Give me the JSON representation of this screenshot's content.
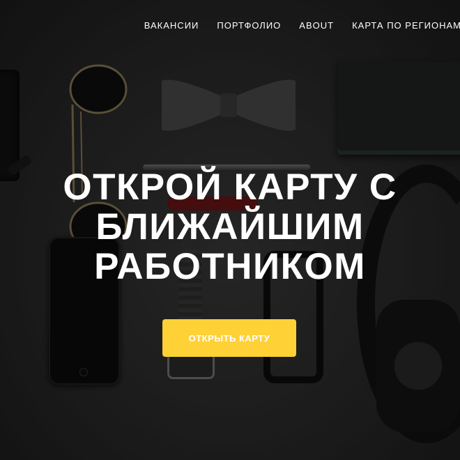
{
  "nav": {
    "items": [
      {
        "label": "ВАКАНСИИ"
      },
      {
        "label": "ПОРТФОЛИО"
      },
      {
        "label": "ABOUT"
      },
      {
        "label": "КАРТА ПО РЕГИОНАМ"
      }
    ]
  },
  "hero": {
    "headline_lines": [
      "ОТКРОЙ КАРТУ С",
      "БЛИЖАЙШИМ",
      "РАБОТНИКОМ"
    ],
    "cta_label": "ОТКРЫТЬ КАРТУ"
  },
  "colors": {
    "accent": "#fed136",
    "text": "#ffffff",
    "background": "#2b2b2b"
  }
}
